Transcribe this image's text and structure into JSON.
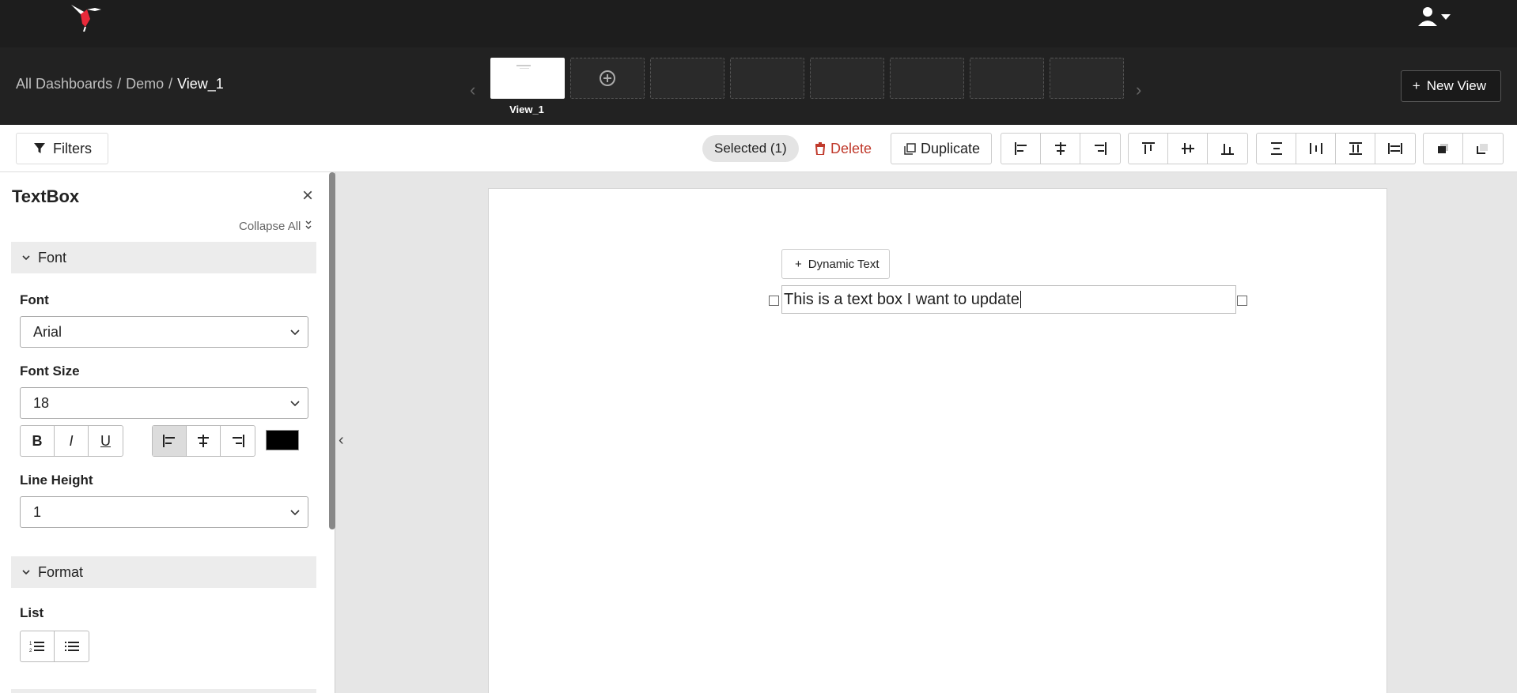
{
  "breadcrumb": {
    "all": "All Dashboards",
    "dashboard": "Demo",
    "view": "View_1",
    "separator": "/"
  },
  "views": {
    "active_label": "View_1"
  },
  "header": {
    "new_view_label": "New View"
  },
  "toolbar": {
    "filters_label": "Filters",
    "selected_label": "Selected (1)",
    "delete_label": "Delete",
    "duplicate_label": "Duplicate"
  },
  "panel": {
    "title": "TextBox",
    "collapse_all_label": "Collapse All",
    "font_section": "Font",
    "font_label": "Font",
    "font_value": "Arial",
    "font_size_label": "Font Size",
    "font_size_value": "18",
    "bold": "B",
    "italic": "I",
    "underline": "U",
    "text_color": "#000000",
    "line_height_label": "Line Height",
    "line_height_value": "1",
    "format_section": "Format",
    "list_label": "List"
  },
  "canvas": {
    "dynamic_text_label": "Dynamic Text",
    "textbox_value": "This is a text box I want to update"
  },
  "colors": {
    "topbar": "#1d1d1d",
    "viewbar": "#222222",
    "delete": "#c0392b",
    "logo_accent": "#e8293a"
  }
}
